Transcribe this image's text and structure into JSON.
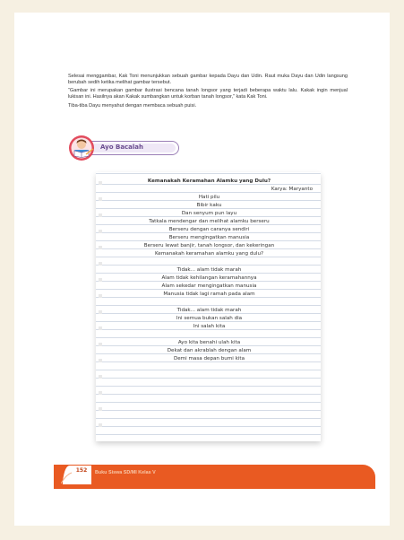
{
  "intro": {
    "paragraphs": [
      "Selesai menggambar, Kak Toni menunjukkan sebuah gambar kepada Dayu dan Udin. Raut muka Dayu dan Udin langsung berubah sedih ketika melihat gambar tersebut.",
      "“Gambar ini merupakan gambar ilustrasi bencana tanah longsor yang terjadi beberapa waktu lalu. Kakak ingin menjual lukisan ini. Hasilnya akan Kakak sumbangkan untuk korban tanah longsor,” kata Kak Toni.",
      "Tiba-tiba Dayu menyahut dengan membaca sebuah puisi."
    ]
  },
  "section_badge": {
    "label": "Ayo Bacalah",
    "icon": "child-reading-book-icon"
  },
  "poem": {
    "title": "Kemanakah Keramahan Alamku yang Dulu?",
    "author": "Karya: Maryanto",
    "lines": [
      "Hati pilu",
      "Bibir kaku",
      "Dan senyum pun layu",
      "Tatkala mendengar dan melihat alamku berseru",
      "Berseru dengan caranya sendiri",
      "Berseru mengingatkan manusia",
      "Berseru lewat banjir, tanah longsor, dan kekeringan",
      "Kemanakah keramahan alamku yang dulu?",
      "",
      "Tidak... alam tidak marah",
      "Alam tidak kehilangan keramahannya",
      "Alam sekedar mengingatkan manusia",
      "Manusia tidak lagi ramah pada alam",
      "",
      "Tidak... alam tidak marah",
      "Ini semua bukan salah dia",
      "Ini salah kita",
      "",
      "Ayo kita benahi ulah kita",
      "Dekat dan akrablah dengan alam",
      "Demi masa depan bumi kita"
    ]
  },
  "footer": {
    "page_number": "152",
    "book_title": "Buku Siswa SD/MI Kelas V"
  },
  "colors": {
    "footer_bar": "#e95a22",
    "badge_border": "#9b7fb7",
    "badge_text": "#6a4d8f",
    "page_background": "#f6f0e2"
  }
}
